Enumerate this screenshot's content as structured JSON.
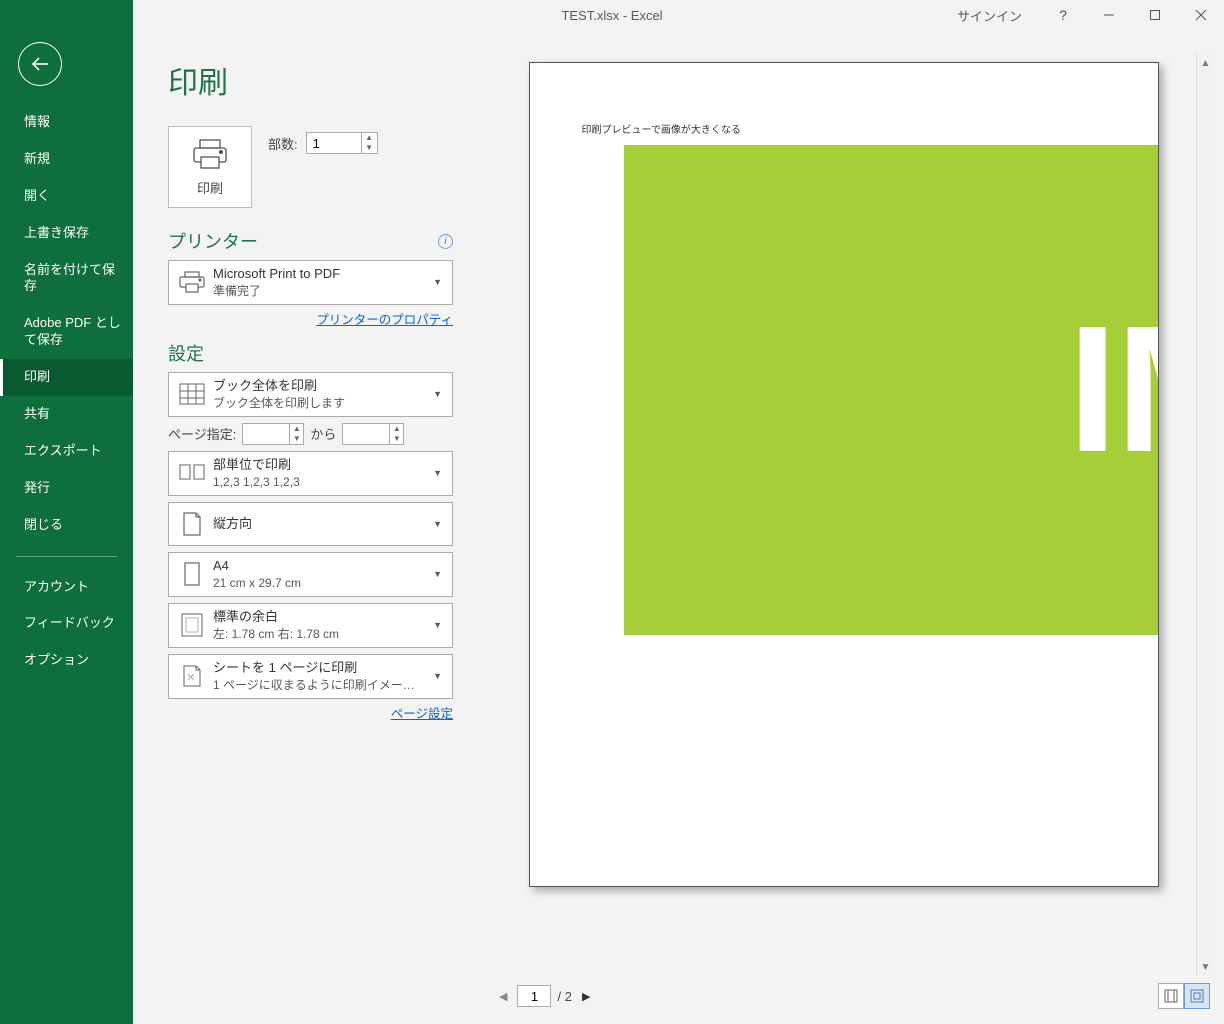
{
  "titlebar": {
    "title": "TEST.xlsx  -  Excel",
    "signin": "サインイン"
  },
  "sidebar": {
    "items": [
      "情報",
      "新規",
      "開く",
      "上書き保存",
      "名前を付けて保存",
      "Adobe PDF として保存",
      "印刷",
      "共有",
      "エクスポート",
      "発行",
      "閉じる"
    ],
    "items2": [
      "アカウント",
      "フィードバック",
      "オプション"
    ],
    "selected": "印刷"
  },
  "panel": {
    "heading": "印刷",
    "print_label": "印刷",
    "copies_label": "部数:",
    "copies_value": "1",
    "printer_section": "プリンター",
    "printer": {
      "name": "Microsoft Print to PDF",
      "status": "準備完了"
    },
    "printer_props": "プリンターのプロパティ",
    "settings_section": "設定",
    "scope": {
      "t1": "ブック全体を印刷",
      "t2": "ブック全体を印刷します"
    },
    "page_spec_label": "ページ指定:",
    "page_from": "",
    "page_to_label": "から",
    "page_to": "",
    "collate": {
      "t1": "部単位で印刷",
      "t2": "1,2,3    1,2,3    1,2,3"
    },
    "orient": {
      "t1": "縦方向"
    },
    "paper": {
      "t1": "A4",
      "t2": "21 cm x 29.7 cm"
    },
    "margin": {
      "t1": "標準の余白",
      "t2": "左:  1.78 cm    右:  1.78 cm"
    },
    "scale": {
      "t1": "シートを 1 ページに印刷",
      "t2": "1 ページに収まるように印刷イメー…"
    },
    "page_setup": "ページ設定"
  },
  "preview": {
    "text": "印刷プレビューで画像が大きくなる",
    "img_text": "IM",
    "page_current": "1",
    "page_total": "/ 2"
  }
}
